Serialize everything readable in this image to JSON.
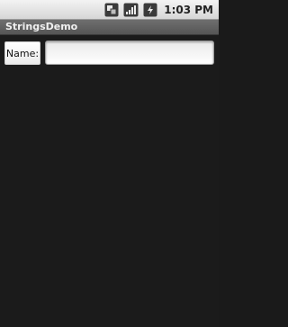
{
  "status_bar": {
    "time": "1:03 PM",
    "icons": [
      "data-sync-icon",
      "signal-strength-icon",
      "battery-icon"
    ]
  },
  "app": {
    "title": "StringsDemo"
  },
  "form": {
    "name_label": "Name:",
    "name_value": "",
    "name_placeholder": ""
  },
  "colors": {
    "background": "#1b1b1b",
    "title_bar": "#5f5f5f",
    "status_bar": "#e0e0e0"
  }
}
